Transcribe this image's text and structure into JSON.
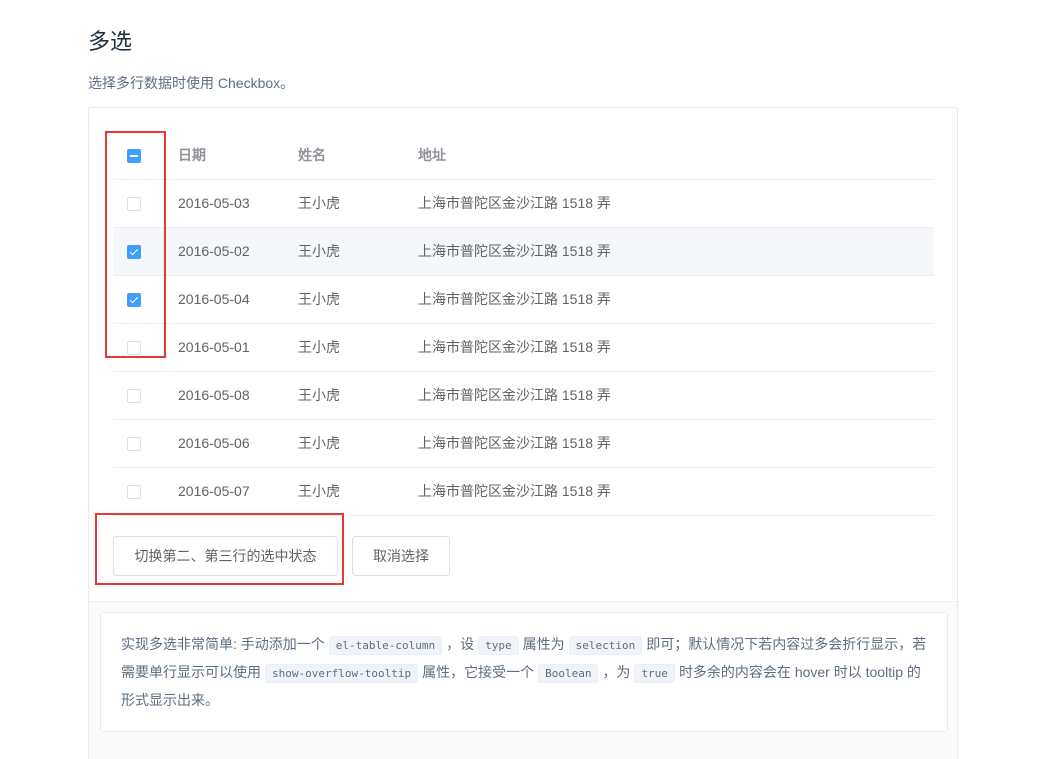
{
  "page": {
    "title": "多选",
    "description": "选择多行数据时使用 Checkbox。"
  },
  "table": {
    "columns": [
      "日期",
      "姓名",
      "地址"
    ],
    "select_all_state": "indeterminate",
    "rows": [
      {
        "date": "2016-05-03",
        "name": "王小虎",
        "address": "上海市普陀区金沙江路 1518 弄",
        "checked": false
      },
      {
        "date": "2016-05-02",
        "name": "王小虎",
        "address": "上海市普陀区金沙江路 1518 弄",
        "checked": true
      },
      {
        "date": "2016-05-04",
        "name": "王小虎",
        "address": "上海市普陀区金沙江路 1518 弄",
        "checked": true
      },
      {
        "date": "2016-05-01",
        "name": "王小虎",
        "address": "上海市普陀区金沙江路 1518 弄",
        "checked": false
      },
      {
        "date": "2016-05-08",
        "name": "王小虎",
        "address": "上海市普陀区金沙江路 1518 弄",
        "checked": false
      },
      {
        "date": "2016-05-06",
        "name": "王小虎",
        "address": "上海市普陀区金沙江路 1518 弄",
        "checked": false
      },
      {
        "date": "2016-05-07",
        "name": "王小虎",
        "address": "上海市普陀区金沙江路 1518 弄",
        "checked": false
      }
    ]
  },
  "buttons": {
    "toggle_label": "切换第二、第三行的选中状态",
    "clear_label": "取消选择"
  },
  "description_box": {
    "p1": "实现多选非常简单: 手动添加一个",
    "code1": "el-table-column",
    "p2": "，设",
    "code2": "type",
    "p3": "属性为",
    "code3": "selection",
    "p4": "即可；默认情况下若内容过多会折行显示，若需要单行显示可以使用",
    "code4": "show-overflow-tooltip",
    "p5": "属性，它接受一个",
    "code5": "Boolean",
    "p6": "，为",
    "code6": "true",
    "p7": "时多余的内容会在 hover 时以 tooltip 的形式显示出来。"
  },
  "colors": {
    "primary": "#409eff",
    "highlight_box": "#e53935",
    "row_hover": "#f5f7fa"
  }
}
